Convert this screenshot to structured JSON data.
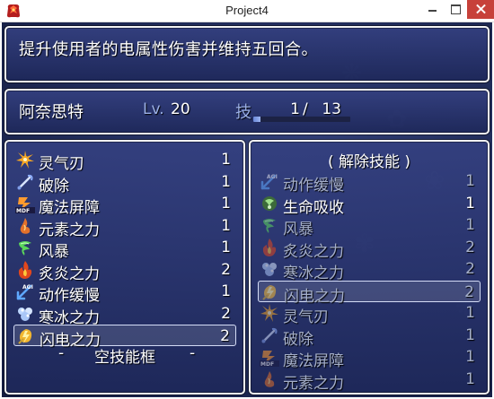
{
  "window": {
    "title": "Project4"
  },
  "help": {
    "text": "提升使用者的电属性伤害并维持五回合。"
  },
  "status": {
    "actor_name": "阿奈思特",
    "level_label": "Lv.",
    "level_value": "20",
    "slot_label": "技",
    "slots_used": "1",
    "slot_separator": "/",
    "slots_max": "13",
    "slot_fill_fraction": 0.077
  },
  "skill_list": {
    "items": [
      {
        "name": "灵气刃",
        "cost": "1",
        "icon": "aura-blade-icon"
      },
      {
        "name": "破除",
        "cost": "1",
        "icon": "dispel-icon"
      },
      {
        "name": "魔法屏障",
        "cost": "1",
        "icon": "magic-barrier-mdf-icon"
      },
      {
        "name": "元素之力",
        "cost": "1",
        "icon": "elemental-power-icon"
      },
      {
        "name": "风暴",
        "cost": "1",
        "icon": "storm-icon"
      },
      {
        "name": "炙炎之力",
        "cost": "2",
        "icon": "flame-power-icon"
      },
      {
        "name": "动作缓慢",
        "cost": "1",
        "icon": "slow-agi-icon"
      },
      {
        "name": "寒冰之力",
        "cost": "2",
        "icon": "ice-power-icon"
      },
      {
        "name": "闪电之力",
        "cost": "2",
        "icon": "lightning-power-icon"
      }
    ],
    "empty_slot": {
      "dash_left": "-",
      "label": "空技能框",
      "dash_right": "-"
    }
  },
  "equipped_list": {
    "header": "( 解除技能 )",
    "items": [
      {
        "name": "动作缓慢",
        "cost": "1",
        "icon": "slow-agi-icon"
      },
      {
        "name": "生命吸收",
        "cost": "1",
        "icon": "life-drain-icon"
      },
      {
        "name": "风暴",
        "cost": "1",
        "icon": "storm-icon"
      },
      {
        "name": "炙炎之力",
        "cost": "2",
        "icon": "flame-power-icon"
      },
      {
        "name": "寒冰之力",
        "cost": "2",
        "icon": "ice-power-icon"
      },
      {
        "name": "闪电之力",
        "cost": "2",
        "icon": "lightning-power-icon"
      },
      {
        "name": "灵气刃",
        "cost": "1",
        "icon": "aura-blade-icon"
      },
      {
        "name": "破除",
        "cost": "1",
        "icon": "dispel-icon"
      },
      {
        "name": "魔法屏障",
        "cost": "1",
        "icon": "magic-barrier-mdf-icon"
      },
      {
        "name": "元素之力",
        "cost": "1",
        "icon": "elemental-power-icon"
      }
    ]
  },
  "icon_text": {
    "mdf": "MDF",
    "agi": "AGI"
  },
  "colors": {
    "window_bg": "#2a3672",
    "system_text": "#9bb0e6",
    "disabled_text": "#a4aec8",
    "close_button": "#c7413a"
  }
}
